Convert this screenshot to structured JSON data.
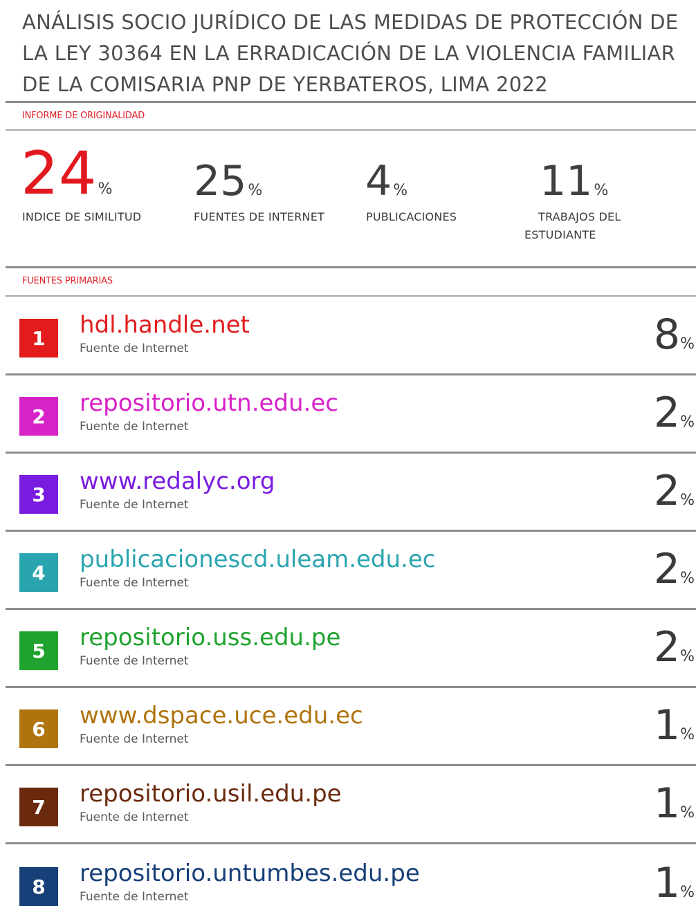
{
  "title": "ANÁLISIS SOCIO JURÍDICO DE LAS MEDIDAS DE PROTECCIÓN DE LA LEY 30364 EN LA ERRADICACIÓN DE LA VIOLENCIA FAMILIAR DE LA COMISARIA PNP DE YERBATEROS, LIMA 2022",
  "originality_label": "INFORME DE ORIGINALIDAD",
  "stats": {
    "similarity": {
      "value": "24",
      "pct": "%",
      "label": "INDICE DE SIMILITUD"
    },
    "internet": {
      "value": "25",
      "pct": "%",
      "label": "FUENTES DE INTERNET"
    },
    "publications": {
      "value": "4",
      "pct": "%",
      "label": "PUBLICACIONES"
    },
    "student": {
      "value": "11",
      "pct": "%",
      "label_line1": "TRABAJOS DEL",
      "label_line2": "ESTUDIANTE"
    }
  },
  "primary_label": "FUENTES PRIMARIAS",
  "sources": [
    {
      "num": "1",
      "domain": "hdl.handle.net",
      "kind": "Fuente de Internet",
      "value": "8",
      "pct": "%",
      "color": "#e21c1c"
    },
    {
      "num": "2",
      "domain": "repositorio.utn.edu.ec",
      "kind": "Fuente de Internet",
      "value": "2",
      "pct": "%",
      "color": "#d722c8"
    },
    {
      "num": "3",
      "domain": "www.redalyc.org",
      "kind": "Fuente de Internet",
      "value": "2",
      "pct": "%",
      "color": "#7a1be0"
    },
    {
      "num": "4",
      "domain": "publicacionescd.uleam.edu.ec",
      "kind": "Fuente de Internet",
      "value": "2",
      "pct": "%",
      "color": "#2aa5b0"
    },
    {
      "num": "5",
      "domain": "repositorio.uss.edu.pe",
      "kind": "Fuente de Internet",
      "value": "2",
      "pct": "%",
      "color": "#1fa32e"
    },
    {
      "num": "6",
      "domain": "www.dspace.uce.edu.ec",
      "kind": "Fuente de Internet",
      "value": "1",
      "pct": "%",
      "color": "#b0740f"
    },
    {
      "num": "7",
      "domain": "repositorio.usil.edu.pe",
      "kind": "Fuente de Internet",
      "value": "1",
      "pct": "%",
      "color": "#6b2a0e"
    },
    {
      "num": "8",
      "domain": "repositorio.untumbes.edu.pe",
      "kind": "Fuente de Internet",
      "value": "1",
      "pct": "%",
      "color": "#173f78"
    }
  ]
}
